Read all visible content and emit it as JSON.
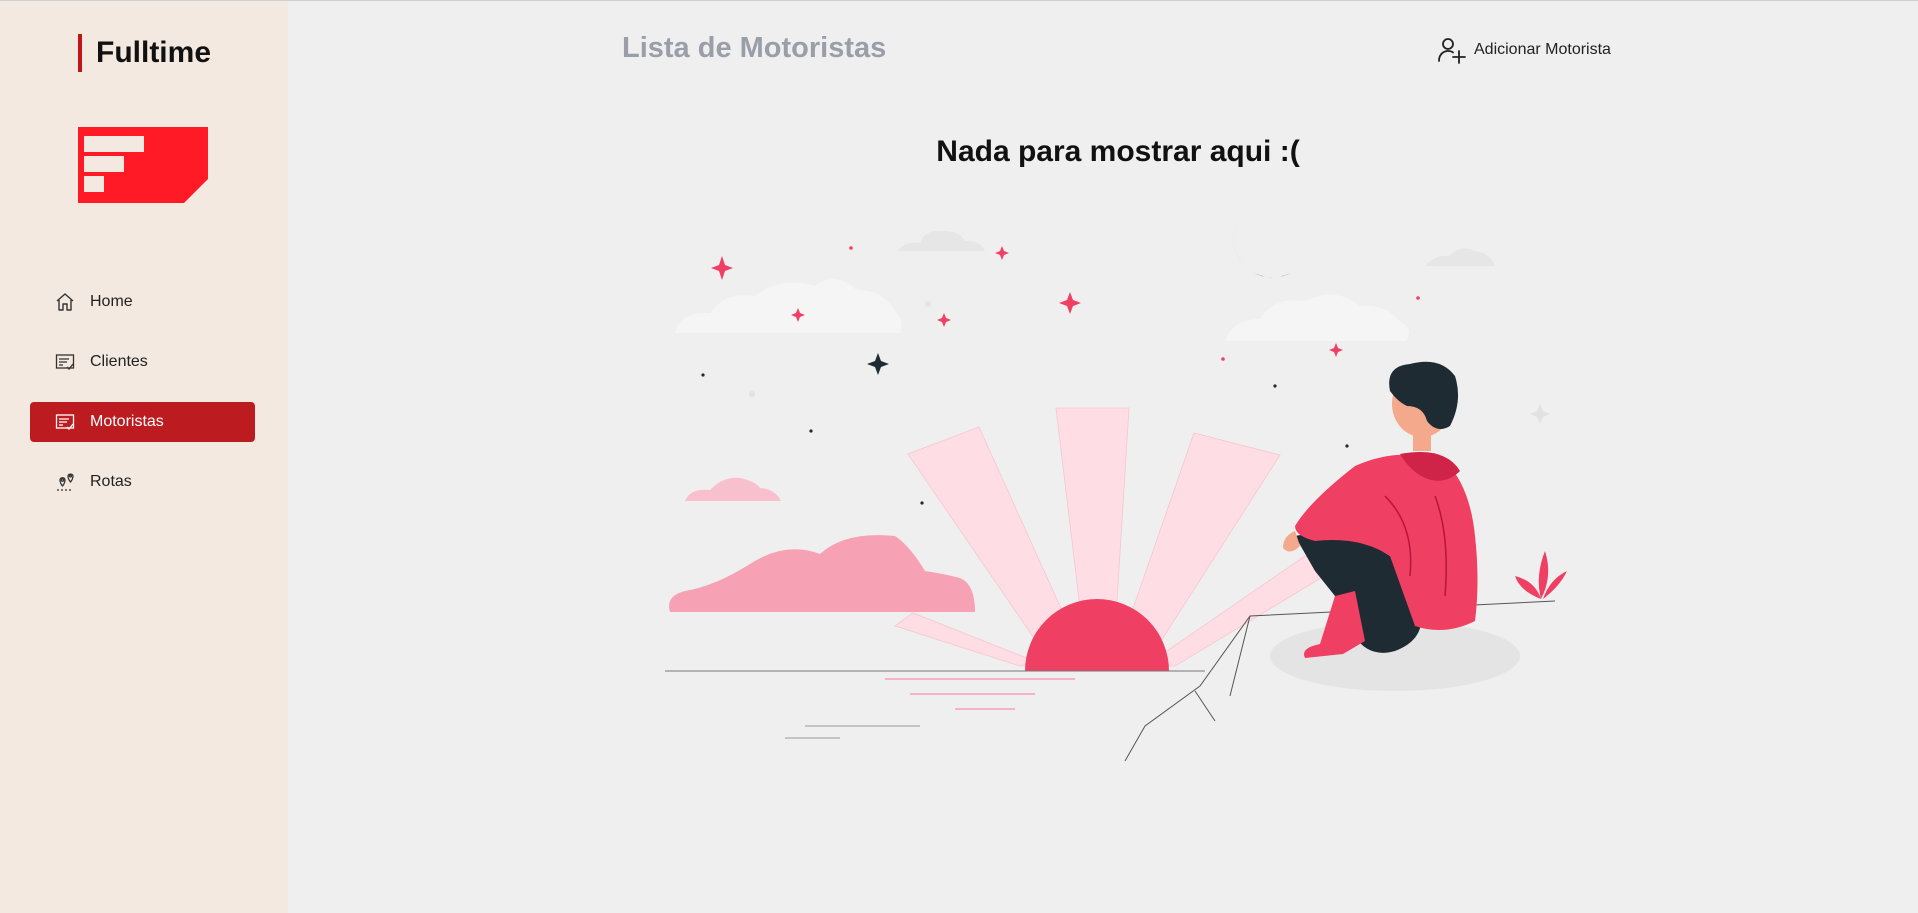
{
  "sidebar": {
    "brand": "Fulltime",
    "logo_icon": "fulltime-logo",
    "items": [
      {
        "label": "Home",
        "icon": "home-icon",
        "active": false
      },
      {
        "label": "Clientes",
        "icon": "list-check-icon",
        "active": false
      },
      {
        "label": "Motoristas",
        "icon": "list-check-icon",
        "active": true
      },
      {
        "label": "Rotas",
        "icon": "map-pin-icon",
        "active": false
      }
    ]
  },
  "header": {
    "title": "Lista de Motoristas",
    "add_button": {
      "label": "Adicionar Motorista",
      "icon": "user-plus-icon"
    }
  },
  "main": {
    "empty_message": "Nada para mostrar aqui :(",
    "illustration": "person-watching-sunset"
  },
  "colors": {
    "accent": "#bc1b1f",
    "logo_red": "#ff1a26",
    "sidebar_bg": "#f3e9e0",
    "page_bg": "#efefef",
    "illustration_pink": "#f0395f"
  }
}
